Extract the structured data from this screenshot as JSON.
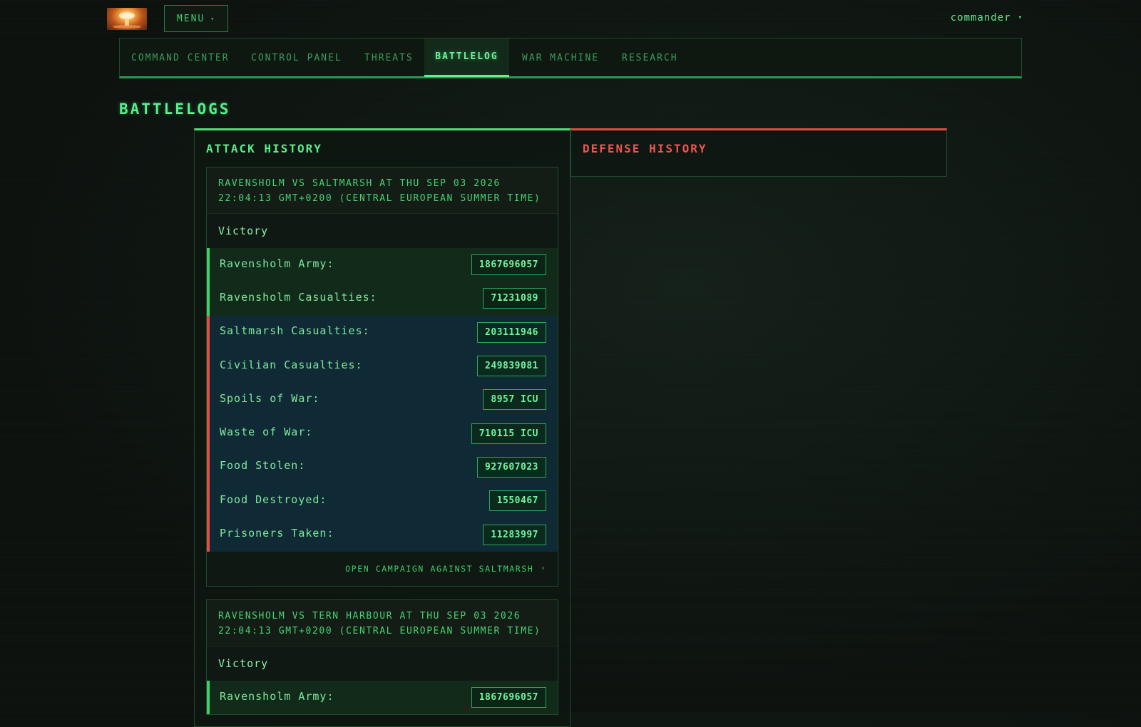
{
  "header": {
    "menu_label": "MENU",
    "menu_caret": "▾",
    "user_name": "commander",
    "user_caret": "▾"
  },
  "nav": {
    "items": [
      {
        "label": "COMMAND CENTER"
      },
      {
        "label": "CONTROL PANEL"
      },
      {
        "label": "THREATS"
      },
      {
        "label": "BATTLELOG"
      },
      {
        "label": "WAR MACHINE"
      },
      {
        "label": "RESEARCH"
      }
    ],
    "active": "BATTLELOG"
  },
  "page": {
    "title": "BATTLELOGS",
    "attack_title": "ATTACK HISTORY",
    "defense_title": "DEFENSE HISTORY"
  },
  "battles": [
    {
      "heading": "RAVENSHOLM VS SALTMARSH AT THU SEP 03 2026 22:04:13 GMT+0200 (CENTRAL EUROPEAN SUMMER TIME)",
      "result": "Victory",
      "rows": [
        {
          "label": "Ravensholm Army:",
          "value": "1867696057",
          "side": "own"
        },
        {
          "label": "Ravensholm Casualties:",
          "value": "71231089",
          "side": "own"
        },
        {
          "label": "Saltmarsh Casualties:",
          "value": "203111946",
          "side": "enemy"
        },
        {
          "label": "Civilian Casualties:",
          "value": "249839081",
          "side": "enemy"
        },
        {
          "label": "Spoils of War:",
          "value": "8957 ICU",
          "side": "enemy"
        },
        {
          "label": "Waste of War:",
          "value": "710115 ICU",
          "side": "enemy"
        },
        {
          "label": "Food Stolen:",
          "value": "927607023",
          "side": "enemy"
        },
        {
          "label": "Food Destroyed:",
          "value": "1550467",
          "side": "enemy"
        },
        {
          "label": "Prisoners Taken:",
          "value": "11283997",
          "side": "enemy"
        }
      ],
      "link": "OPEN CAMPAIGN AGAINST SALTMARSH",
      "link_arrow": "›"
    },
    {
      "heading": "RAVENSHOLM VS TERN HARBOUR AT THU SEP 03 2026 22:04:13 GMT+0200 (CENTRAL EUROPEAN SUMMER TIME)",
      "result": "Victory",
      "rows": [
        {
          "label": "Ravensholm Army:",
          "value": "1867696057",
          "side": "own"
        }
      ]
    }
  ],
  "colors": {
    "accent": "#4ee07c",
    "enemy": "#e84a46",
    "own_row_bg": "#122a1a",
    "enemy_row_bg": "#0f2a35"
  }
}
